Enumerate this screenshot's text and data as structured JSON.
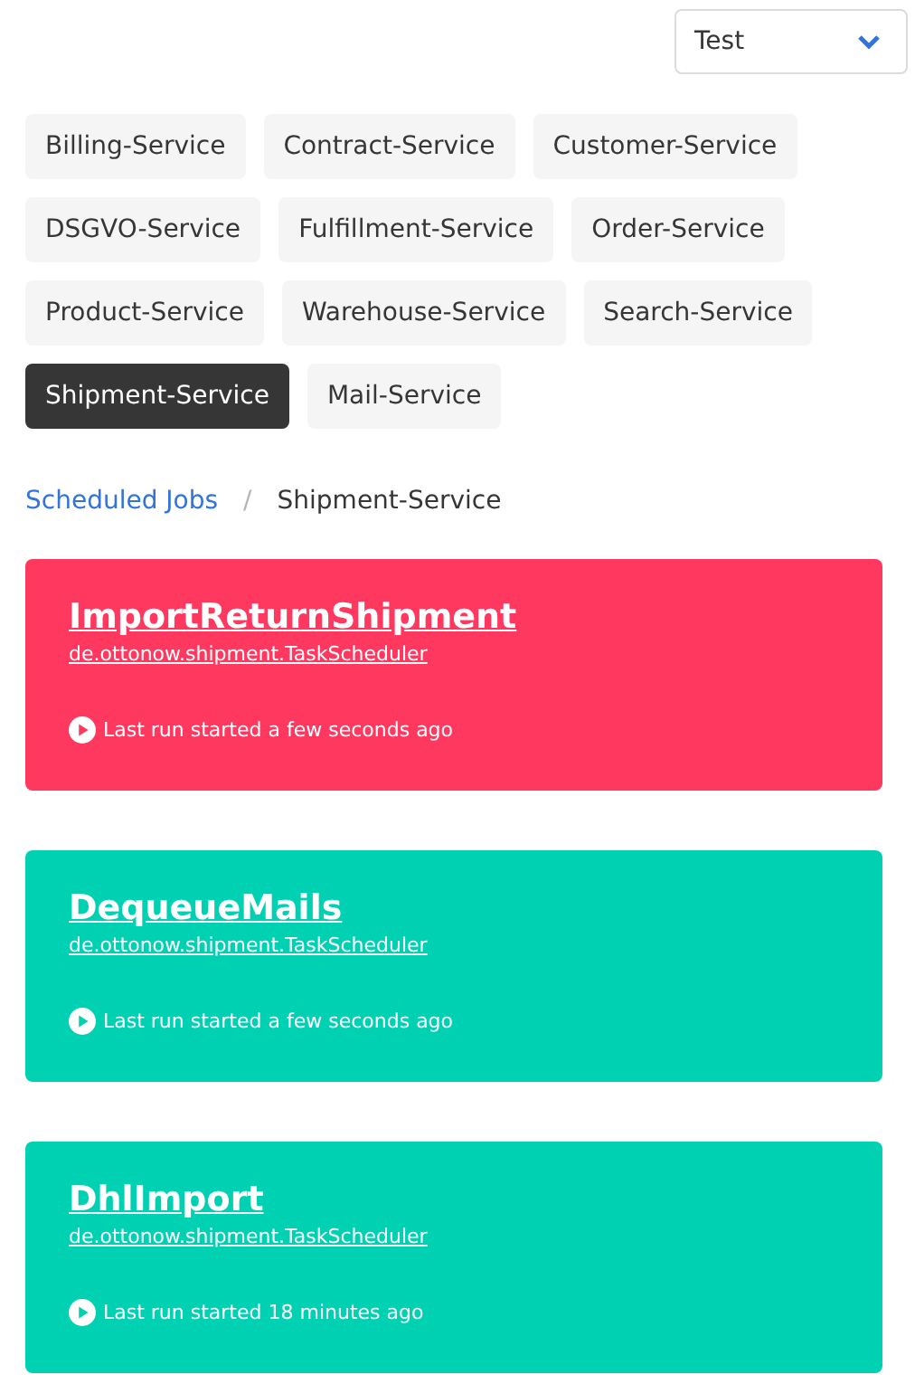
{
  "environment_select": {
    "value": "Test"
  },
  "services": [
    {
      "label": "Billing-Service",
      "selected": false
    },
    {
      "label": "Contract-Service",
      "selected": false
    },
    {
      "label": "Customer-Service",
      "selected": false
    },
    {
      "label": "DSGVO-Service",
      "selected": false
    },
    {
      "label": "Fulfillment-Service",
      "selected": false
    },
    {
      "label": "Order-Service",
      "selected": false
    },
    {
      "label": "Product-Service",
      "selected": false
    },
    {
      "label": "Warehouse-Service",
      "selected": false
    },
    {
      "label": "Search-Service",
      "selected": false
    },
    {
      "label": "Shipment-Service",
      "selected": true
    },
    {
      "label": "Mail-Service",
      "selected": false
    }
  ],
  "breadcrumb": {
    "link": "Scheduled Jobs",
    "separator": "/",
    "current": "Shipment-Service"
  },
  "jobs": [
    {
      "name": "ImportReturnShipment",
      "scheduler": "de.ottonow.shipment.TaskScheduler",
      "color": "#ff3860",
      "last_run": "Last run started a few seconds ago"
    },
    {
      "name": "DequeueMails",
      "scheduler": "de.ottonow.shipment.TaskScheduler",
      "color": "#00d1b2",
      "last_run": "Last run started a few seconds ago"
    },
    {
      "name": "DhlImport",
      "scheduler": "de.ottonow.shipment.TaskScheduler",
      "color": "#00d1b2",
      "last_run": "Last run started 18 minutes ago"
    }
  ]
}
